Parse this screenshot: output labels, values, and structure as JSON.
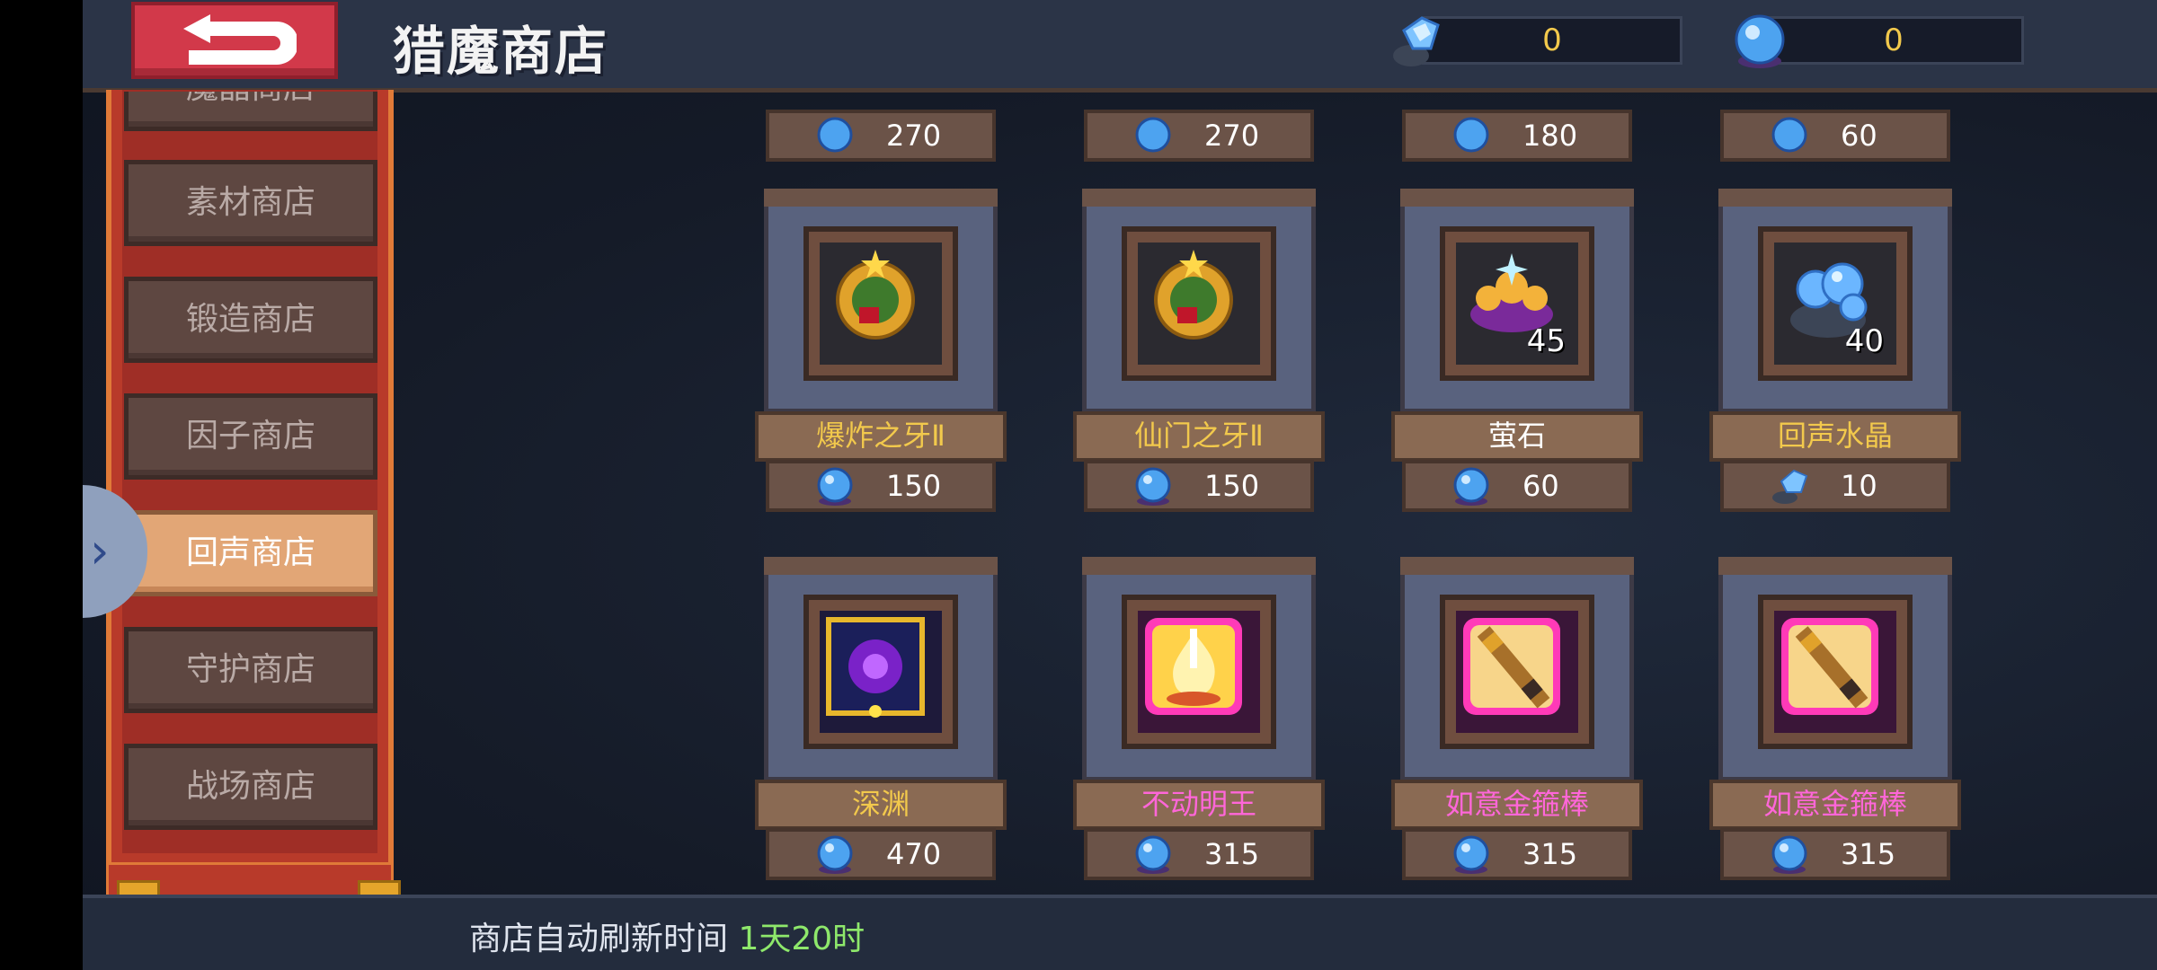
{
  "header": {
    "title": "猎魔商店"
  },
  "currencies": [
    {
      "name": "echo-crystal-currency",
      "value": "0"
    },
    {
      "name": "blue-gem-currency",
      "value": "0"
    }
  ],
  "menu": [
    {
      "label": "魔晶商店"
    },
    {
      "label": "素材商店"
    },
    {
      "label": "锻造商店"
    },
    {
      "label": "因子商店"
    },
    {
      "label": "回声商店",
      "active": true
    },
    {
      "label": "守护商店"
    },
    {
      "label": "战场商店"
    }
  ],
  "partial_row_prices": [
    "270",
    "270",
    "180",
    "60"
  ],
  "items": [
    {
      "name": "爆炸之牙Ⅱ",
      "price": "150",
      "currency": "blue-gem",
      "name_color": "#f2c94c",
      "icon": "gold-badge-icon"
    },
    {
      "name": "仙门之牙Ⅱ",
      "price": "150",
      "currency": "blue-gem",
      "name_color": "#f2c94c",
      "icon": "gold-badge-icon"
    },
    {
      "name": "萤石",
      "price": "60",
      "currency": "blue-gem",
      "qty": "45",
      "name_color": "#ffffff",
      "icon": "fluorite-icon"
    },
    {
      "name": "回声水晶",
      "price": "10",
      "currency": "echo-crystal",
      "qty": "40",
      "name_color": "#f2c94c",
      "icon": "echo-crystal-icon"
    },
    {
      "name": "深渊",
      "price": "470",
      "currency": "blue-gem",
      "name_color": "#f2c94c",
      "icon": "abyss-icon"
    },
    {
      "name": "不动明王",
      "price": "315",
      "currency": "blue-gem",
      "name_color": "#ff66d9",
      "icon": "flame-king-icon"
    },
    {
      "name": "如意金箍棒",
      "price": "315",
      "currency": "blue-gem",
      "name_color": "#ff66d9",
      "icon": "golden-staff-icon"
    },
    {
      "name": "如意金箍棒",
      "price": "315",
      "currency": "blue-gem",
      "name_color": "#ff66d9",
      "icon": "golden-staff-icon"
    }
  ],
  "footer": {
    "label": "商店自动刷新时间",
    "time": "1天20时"
  }
}
